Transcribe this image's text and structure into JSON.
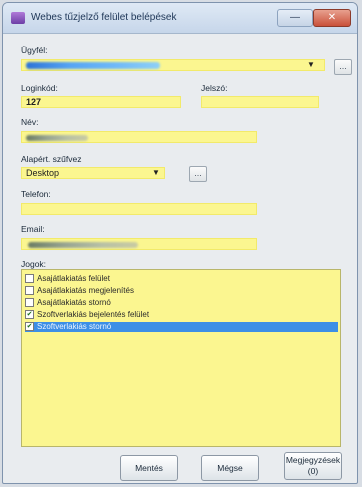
{
  "window": {
    "title": "Webes tűzjelző felület belépések",
    "minimize_label": "—",
    "close_label": "✕"
  },
  "form": {
    "client_label": "Ügyfél:",
    "client_value": "",
    "logincode_label": "Loginkód:",
    "logincode_value": "127",
    "password_label": "Jelszó:",
    "password_value": "",
    "name_label": "Név:",
    "name_value": "",
    "basic_rights_label": "Alapért. szűfvez",
    "basic_rights_value": "Desktop",
    "phone_label": "Telefon:",
    "phone_value": "",
    "email_label": "Email:",
    "email_value": ""
  },
  "rights": {
    "label": "Jogok:",
    "items": [
      {
        "label": "Asajátlakiatás felület",
        "checked": false
      },
      {
        "label": "Asajátlakiatás megjelenítés",
        "checked": false
      },
      {
        "label": "Asajátlakiatás stornó",
        "checked": false
      },
      {
        "label": "Szoftverlakiás bejelentés felület",
        "checked": true
      },
      {
        "label": "Szoftverlakiás stornó",
        "checked": true
      }
    ],
    "selected_index": 4
  },
  "buttons": {
    "save": "Mentés",
    "help": "Mégse",
    "cancel_line1": "Megjegyzések",
    "cancel_line2": "(0)"
  },
  "icons": {
    "dropdown_arrow": "▼",
    "browse": "…",
    "check": "✔"
  }
}
